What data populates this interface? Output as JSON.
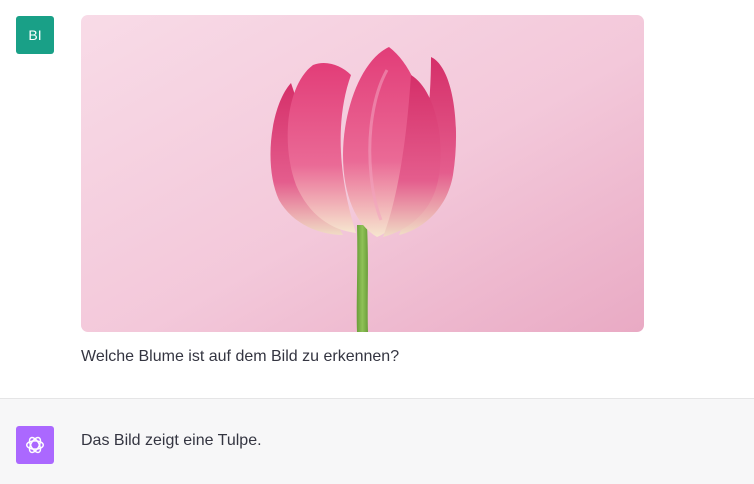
{
  "conversation": {
    "user_message": {
      "avatar_initials": "BI",
      "avatar_color": "#19a087",
      "image_subject": "pink-tulip-photo",
      "text": "Welche Blume ist auf dem Bild zu erkennen?"
    },
    "assistant_message": {
      "avatar_icon": "openai-logo-icon",
      "avatar_color": "#ab68ff",
      "text": "Das Bild zeigt eine Tulpe."
    }
  },
  "colors": {
    "assistant_background": "#f7f7f8",
    "text": "#343541",
    "image_background": "#f5cadb",
    "tulip": "#e04a7e"
  }
}
